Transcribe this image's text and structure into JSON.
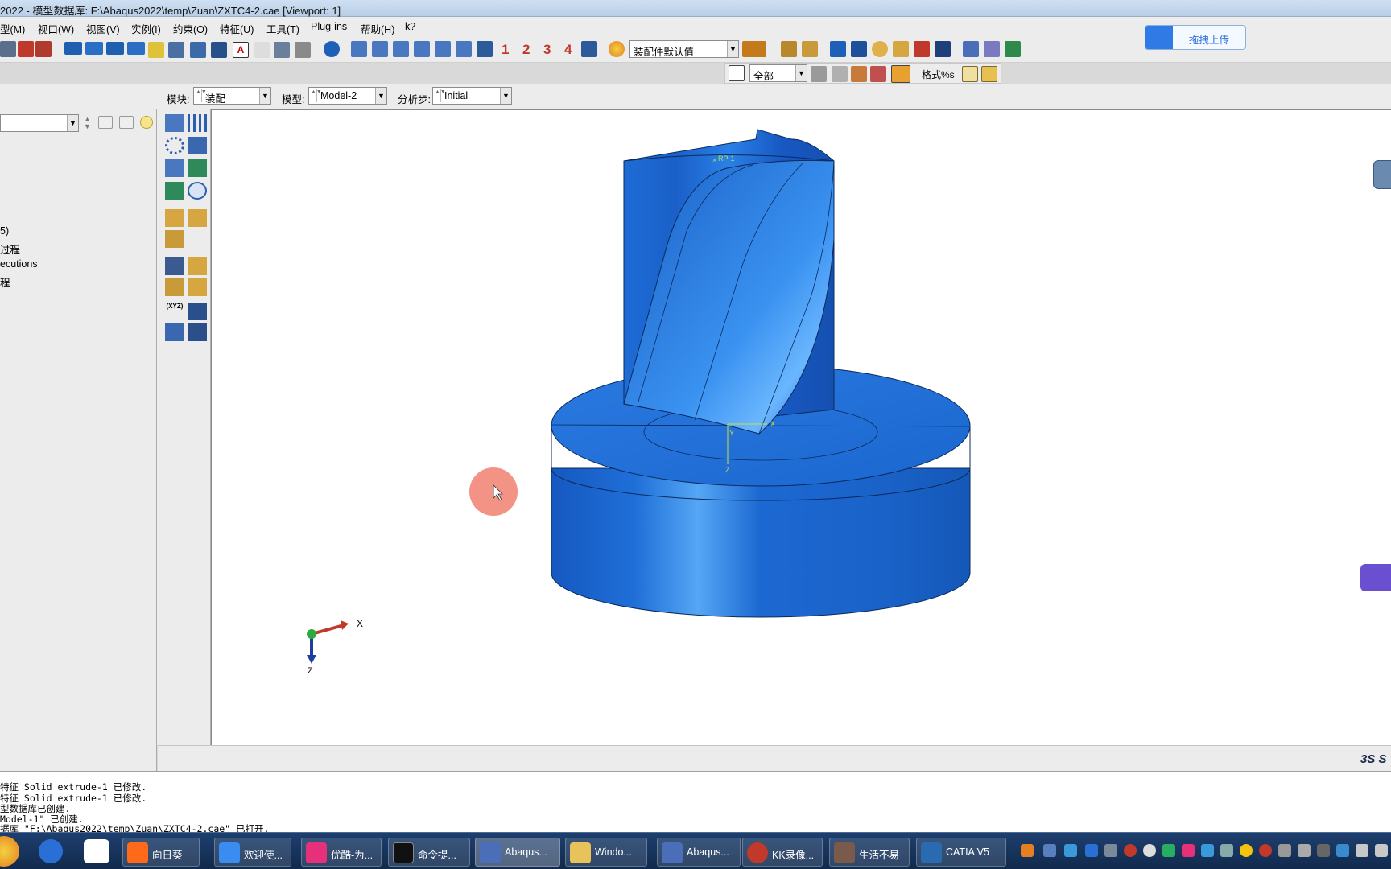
{
  "title": "2022 - 模型数据库: F:\\Abaqus2022\\temp\\Zuan\\ZXTC4-2.cae [Viewport: 1]",
  "menu": [
    "型(M)",
    "视口(W)",
    "视图(V)",
    "实例(I)",
    "约束(O)",
    "特征(U)",
    "工具(T)",
    "Plug-ins",
    "帮助(H)",
    "k?"
  ],
  "toolbar": {
    "numbers": [
      "1",
      "2",
      "3",
      "4"
    ],
    "render_style": "装配件默认值",
    "selection_filter": "全部",
    "format_label": "格式%s"
  },
  "context": {
    "module_label": "模块:",
    "module_value": "装配",
    "model_label": "模型:",
    "model_value": "Model-2",
    "step_label": "分析步:",
    "step_value": "Initial"
  },
  "tree_items": [
    "5)",
    "过程",
    "ecutions",
    "程"
  ],
  "viewport": {
    "rp_label": "RP-1",
    "csys_x": "X",
    "csys_y": "Y",
    "csys_z": "Z",
    "triad_x": "X",
    "triad_z": "Z",
    "brand": "3S S",
    "part_color": "#1a6fd6"
  },
  "upload_button": "拖拽上传",
  "messages": [
    "特征 Solid extrude-1 已修改.",
    "特征 Solid extrude-1 已修改.",
    "型数据库已创建.",
    "Model-1\" 已创建.",
    "据库 \"F:\\Abaqus2022\\temp\\Zuan\\ZXTC4-2.cae\" 已打开."
  ],
  "taskbar": [
    {
      "label": "向日葵",
      "color": "#ff6a1a"
    },
    {
      "label": "欢迎使...",
      "color": "#3b8cf0"
    },
    {
      "label": "优酷-为...",
      "color": "#e6307a"
    },
    {
      "label": "命令提...",
      "color": "#111111"
    },
    {
      "label": "Abaqus...",
      "color": "#4a6fb8"
    },
    {
      "label": "Windo...",
      "color": "#e8c35a"
    },
    {
      "label": "Abaqus...",
      "color": "#4a6fb8"
    },
    {
      "label": "KK录像...",
      "color": "#c0392b"
    },
    {
      "label": "生活不易",
      "color": "#7a5a4a"
    },
    {
      "label": "CATIA V5",
      "color": "#2a6ab0"
    }
  ]
}
